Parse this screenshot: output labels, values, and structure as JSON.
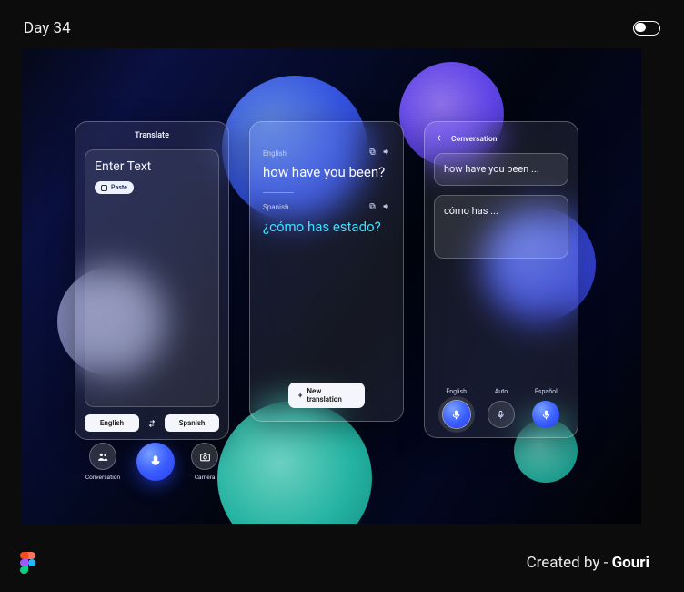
{
  "topbar": {
    "day_label": "Day 34"
  },
  "colors": {
    "accent_blue": "#3a5dff",
    "accent_cyan": "#38e1ff"
  },
  "card1": {
    "title": "Translate",
    "placeholder": "Enter Text",
    "paste_label": "Paste",
    "lang_from": "English",
    "lang_to": "Spanish",
    "actions": {
      "conversation": "Conversation",
      "mic": "Mic",
      "camera": "Camera"
    }
  },
  "card2": {
    "src_lang": "English",
    "src_text": "how have you been?",
    "dst_lang": "Spanish",
    "dst_text": "¿cómo has estado?",
    "new_translation": "New translation"
  },
  "card3": {
    "title": "Conversation",
    "bubble1": "how have you been ...",
    "bubble2": "cómo has ...",
    "mic_labels": {
      "left": "English",
      "mid": "Auto",
      "right": "Español"
    }
  },
  "footer": {
    "created_by_prefix": "Created by - ",
    "author": "Gouri"
  }
}
